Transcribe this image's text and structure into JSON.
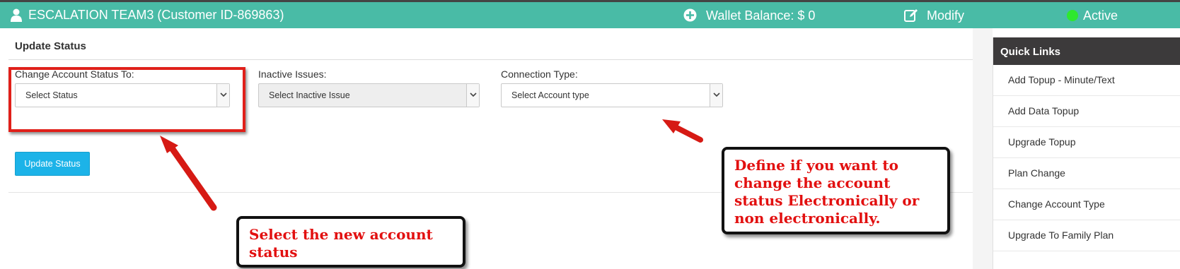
{
  "header": {
    "title": "ESCALATION TEAM3 (Customer ID-869863)",
    "wallet": "Wallet Balance: $ 0",
    "modify": "Modify",
    "status": "Active",
    "colors": {
      "bar": "#49bba6",
      "status_dot": "#2ee82e"
    }
  },
  "panel": {
    "title": "Update Status",
    "account_status": {
      "label": "Change Account Status To:",
      "value": "Select Status"
    },
    "inactive_issues": {
      "label": "Inactive Issues:",
      "value": "Select Inactive Issue"
    },
    "connection_type": {
      "label": "Connection Type:",
      "value": "Select Account type"
    },
    "update_button": "Update Status"
  },
  "annotations": {
    "callout_status": "Select the new account status",
    "callout_connection": "Define if you want to change the account status Electronically or non electronically.",
    "colors": {
      "highlight": "#e0201a",
      "callout_text": "#e21010"
    }
  },
  "quick_links": {
    "title": "Quick Links",
    "items": [
      "Add Topup - Minute/Text",
      "Add Data Topup",
      "Upgrade Topup",
      "Plan Change",
      "Change Account Type",
      "Upgrade To Family Plan"
    ]
  },
  "icons": [
    "user-icon",
    "plus-circle-icon",
    "edit-icon",
    "status-dot-icon",
    "chevron-down-icon",
    "arrow-icon"
  ]
}
